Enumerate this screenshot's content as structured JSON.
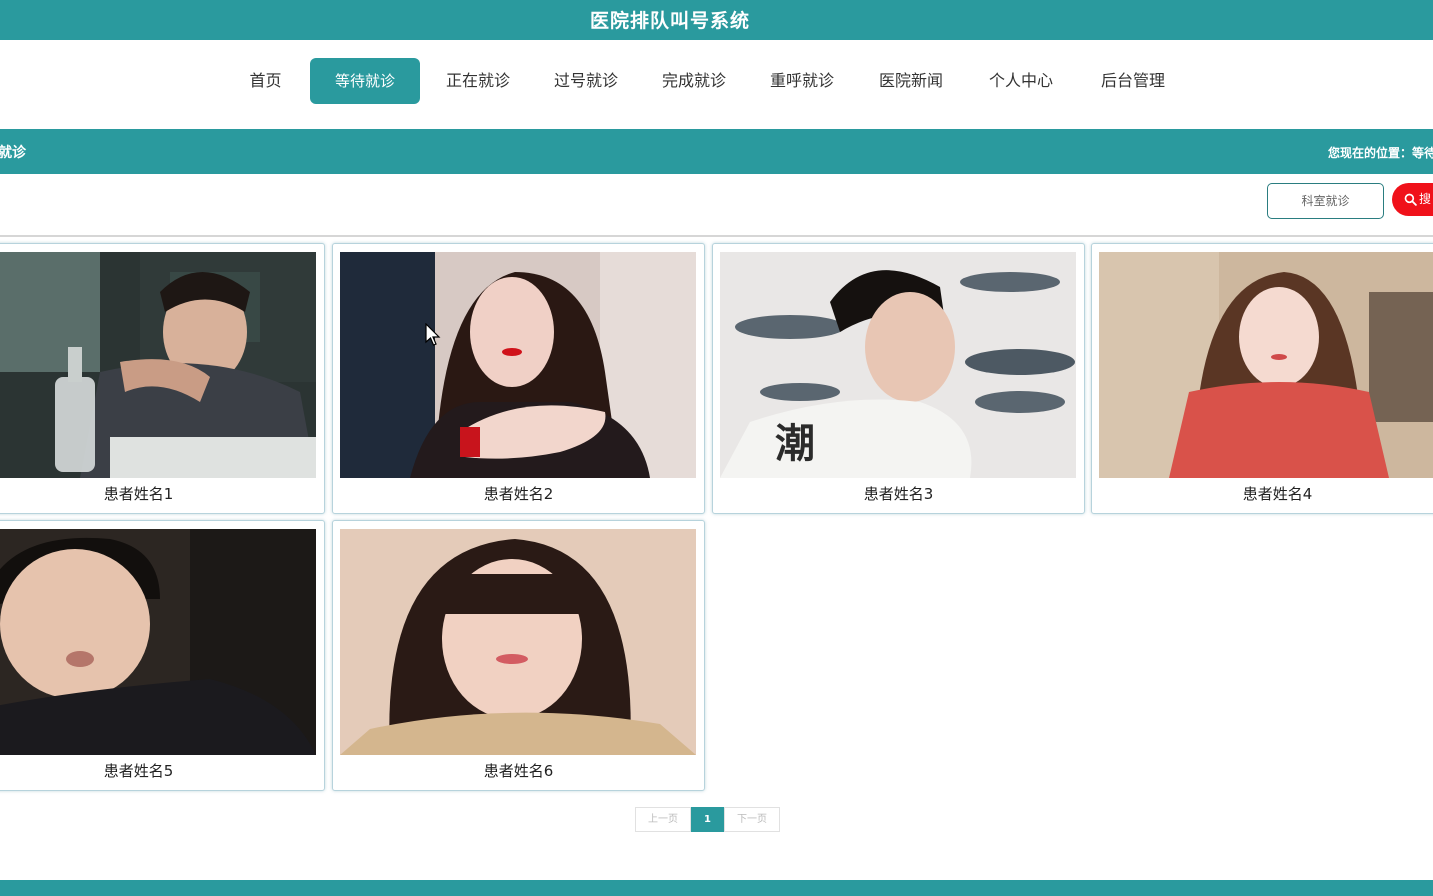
{
  "header": {
    "title": "医院排队叫号系统"
  },
  "nav": {
    "items": [
      {
        "label": "首页"
      },
      {
        "label": "等待就诊",
        "active": true
      },
      {
        "label": "正在就诊"
      },
      {
        "label": "过号就诊"
      },
      {
        "label": "完成就诊"
      },
      {
        "label": "重呼就诊"
      },
      {
        "label": "医院新闻"
      },
      {
        "label": "个人中心"
      },
      {
        "label": "后台管理"
      }
    ]
  },
  "breadcrumb": {
    "section_title": "就诊",
    "location": "您现在的位置：等待"
  },
  "toolbar": {
    "filter_label": "科室就诊",
    "search_label": "搜"
  },
  "patients": [
    {
      "name": "患者姓名1"
    },
    {
      "name": "患者姓名2"
    },
    {
      "name": "患者姓名3"
    },
    {
      "name": "患者姓名4"
    },
    {
      "name": "患者姓名5"
    },
    {
      "name": "患者姓名6"
    }
  ],
  "pagination": {
    "prev_label": "上一页",
    "current_page": "1",
    "next_label": "下一页"
  },
  "colors": {
    "primary": "#2a9a9e",
    "search_button": "#f0111a"
  }
}
